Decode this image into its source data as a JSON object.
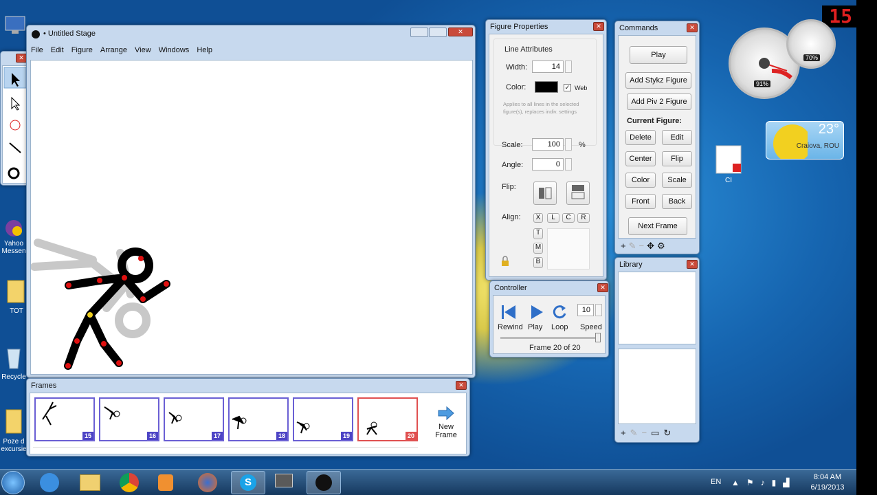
{
  "corner_counter": "15",
  "stage_window": {
    "title": "Untitled Stage",
    "menu": [
      "File",
      "Edit",
      "Figure",
      "Arrange",
      "View",
      "Windows",
      "Help"
    ]
  },
  "frames_window": {
    "title": "Frames",
    "frame_numbers": [
      "15",
      "16",
      "17",
      "18",
      "19",
      "20"
    ],
    "new_frame_label_1": "New",
    "new_frame_label_2": "Frame"
  },
  "figure_properties": {
    "title": "Figure Properties",
    "line_attributes": "Line Attributes",
    "width_label": "Width:",
    "width_value": "14",
    "color_label": "Color:",
    "web_label": "Web",
    "note": "Applies to all lines in the selected figure(s), replaces indiv. settings",
    "scale_label": "Scale:",
    "scale_value": "100",
    "percent": "%",
    "angle_label": "Angle:",
    "angle_value": "0",
    "flip_label": "Flip:",
    "align_label": "Align:",
    "align_x": "X",
    "align_l": "L",
    "align_c": "C",
    "align_r": "R",
    "align_t": "T",
    "align_m": "M",
    "align_b": "B"
  },
  "commands": {
    "title": "Commands",
    "play": "Play",
    "add_stykz": "Add Stykz Figure",
    "add_piv2": "Add Piv 2 Figure",
    "current_figure": "Current Figure:",
    "delete": "Delete",
    "edit": "Edit",
    "center": "Center",
    "flip": "Flip",
    "color": "Color",
    "scale": "Scale",
    "front": "Front",
    "back": "Back",
    "next_frame": "Next Frame"
  },
  "library": {
    "title": "Library"
  },
  "controller": {
    "title": "Controller",
    "rewind": "Rewind",
    "play": "Play",
    "loop": "Loop",
    "speed": "Speed",
    "speed_value": "10",
    "frame_status": "Frame 20 of 20"
  },
  "gadgets": {
    "cpu": "91%",
    "ram": "70%",
    "temperature": "23°",
    "location": "Craiova, ROU"
  },
  "desktop_icons": {
    "yahoo_1": "Yahoo",
    "yahoo_2": "Messen",
    "tot": "TOT",
    "recycle": "Recycle",
    "poze_1": "Poze d",
    "poze_2": "excursie",
    "ci": "CI"
  },
  "taskbar": {
    "language": "EN",
    "time": "8:04 AM",
    "date": "6/19/2013"
  },
  "colors": {
    "frame_border": "#6a5fd4",
    "frame_current": "#e05050",
    "stick": "#000000",
    "joint": "#e01010"
  }
}
